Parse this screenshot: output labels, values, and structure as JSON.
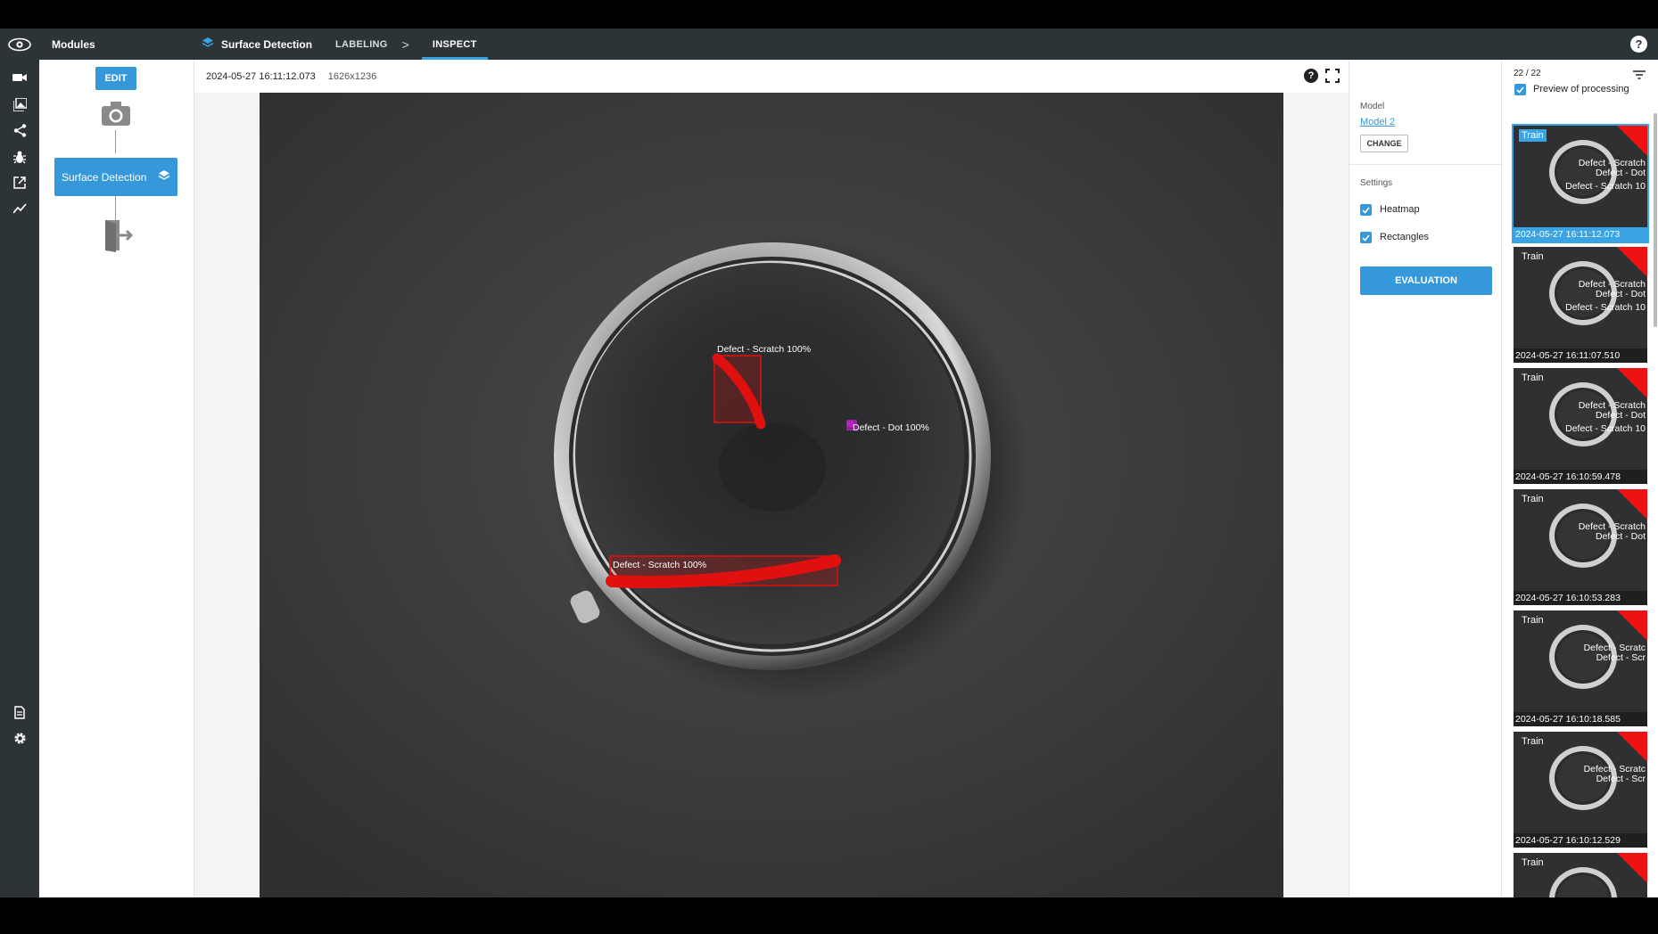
{
  "topbar": {
    "modules_label": "Modules",
    "app_name": "Surface Detection",
    "crumb_labeling": "LABELING",
    "crumb_separator": ">",
    "crumb_inspect": "INSPECT",
    "help_glyph": "?"
  },
  "flow": {
    "edit_label": "EDIT",
    "node_label": "Surface Detection"
  },
  "image": {
    "timestamp": "2024-05-27 16:11:12.073",
    "resolution": "1626x1236",
    "help_glyph": "?",
    "detections": [
      {
        "label": "Defect - Scratch 100%",
        "color": "#e01010"
      },
      {
        "label": "Defect - Dot 100%",
        "color": "#c020c0"
      },
      {
        "label": "Defect - Scratch 100%",
        "color": "#e01010"
      }
    ]
  },
  "settings": {
    "model_title": "Model",
    "model_name": "Model 2",
    "change_label": "CHANGE",
    "settings_title": "Settings",
    "heatmap_label": "Heatmap",
    "heatmap_checked": true,
    "rectangles_label": "Rectangles",
    "rectangles_checked": true,
    "evaluation_label": "EVALUATION"
  },
  "thumbnails": {
    "count": "22 / 22",
    "preview_label": "Preview of processing",
    "preview_checked": true,
    "items": [
      {
        "tag": "Train",
        "line1": "Defect - Scratch",
        "line2": "Defect - Dot",
        "line3": "Defect - Scratch 10",
        "timestamp": "2024-05-27 16:11:12.073",
        "selected": true
      },
      {
        "tag": "Train",
        "line1": "Defect - Scratch",
        "line2": "Defect - Dot",
        "line3": "Defect - Scratch 10",
        "timestamp": "2024-05-27 16:11:07.510",
        "selected": false
      },
      {
        "tag": "Train",
        "line1": "Defect - Scratch",
        "line2": "Defect - Dot",
        "line3": "Defect - Scratch 10",
        "timestamp": "2024-05-27 16:10:59.478",
        "selected": false
      },
      {
        "tag": "Train",
        "line1": "Defect - Scratch",
        "line2": "Defect - Dot",
        "line3": "",
        "timestamp": "2024-05-27 16:10:53.283",
        "selected": false
      },
      {
        "tag": "Train",
        "line1": "Defect - Scratc",
        "line2": "Defect - Scr",
        "line3": "",
        "timestamp": "2024-05-27 16:10:18.585",
        "selected": false
      },
      {
        "tag": "Train",
        "line1": "Defect - Scratc",
        "line2": "Defect - Scr",
        "line3": "",
        "timestamp": "2024-05-27 16:10:12.529",
        "selected": false
      },
      {
        "tag": "Train",
        "line1": "",
        "line2": "",
        "line3": "",
        "timestamp": "",
        "selected": false
      }
    ]
  },
  "colors": {
    "accent": "#3498db",
    "topbar": "#2d3438",
    "defect_scratch": "#e01010",
    "defect_dot": "#c020c0"
  }
}
